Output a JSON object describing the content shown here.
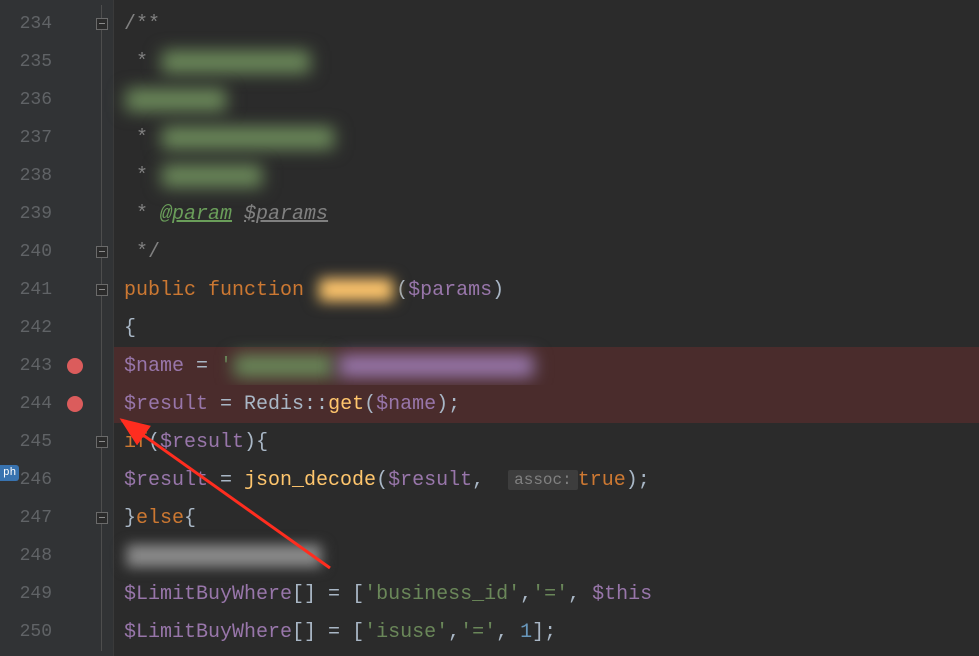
{
  "lines": [
    {
      "num": "234",
      "breakpoint": false,
      "fold": true
    },
    {
      "num": "235",
      "breakpoint": false,
      "fold": false
    },
    {
      "num": "236",
      "breakpoint": false,
      "fold": false
    },
    {
      "num": "237",
      "breakpoint": false,
      "fold": false
    },
    {
      "num": "238",
      "breakpoint": false,
      "fold": false
    },
    {
      "num": "239",
      "breakpoint": false,
      "fold": false
    },
    {
      "num": "240",
      "breakpoint": false,
      "fold": true
    },
    {
      "num": "241",
      "breakpoint": false,
      "fold": true
    },
    {
      "num": "242",
      "breakpoint": false,
      "fold": false
    },
    {
      "num": "243",
      "breakpoint": true,
      "fold": false,
      "hl": true
    },
    {
      "num": "244",
      "breakpoint": true,
      "fold": false,
      "hl": true
    },
    {
      "num": "245",
      "breakpoint": false,
      "fold": true
    },
    {
      "num": "246",
      "breakpoint": false,
      "fold": false
    },
    {
      "num": "247",
      "breakpoint": false,
      "fold": true
    },
    {
      "num": "248",
      "breakpoint": false,
      "fold": false
    },
    {
      "num": "249",
      "breakpoint": false,
      "fold": false
    },
    {
      "num": "250",
      "breakpoint": false,
      "fold": false
    }
  ],
  "tokens": {
    "comment_open": "/**",
    "comment_star": " * ",
    "doctag": "@param",
    "docparam": "$params",
    "comment_close": " */",
    "kw_public": "public",
    "kw_function": "function",
    "var_params": "$params",
    "brace_open": "{",
    "var_name": "$name",
    "assign": " = ",
    "string_open": "'",
    "var_result": "$result",
    "class_redis": "Redis",
    "dbl_colon": "::",
    "method_get": "get",
    "semi": ";",
    "kw_if": "if",
    "kw_else": "else",
    "fn_json_decode": "json_decode",
    "hint_assoc": "assoc:",
    "bool_true": "true",
    "var_limitbuy": "$LimitBuyWhere",
    "brackets": "[]",
    "str_business_id": "'business_id'",
    "str_eq": "'='",
    "var_this": "$this",
    "str_isuse": "'isuse'",
    "num_one": "1",
    "paren_open": "(",
    "paren_close": ")",
    "brace_close": "}",
    "comma": ", ",
    "arr_open": "[",
    "arr_close": "]",
    "sidetab": "ph"
  },
  "colors": {
    "arrow": "#ff2d1f"
  }
}
